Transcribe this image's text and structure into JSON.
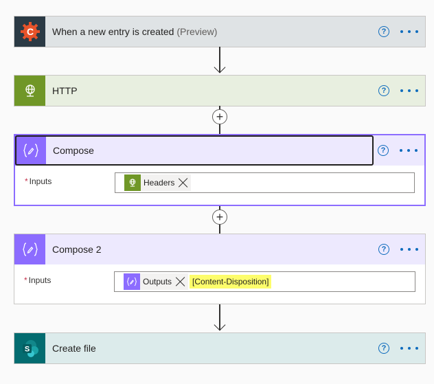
{
  "steps": [
    {
      "title": "When a new entry is created",
      "title_suffix": "(Preview)",
      "icon": "cognito-forms-icon"
    },
    {
      "title": "HTTP",
      "icon": "globe-icon"
    },
    {
      "title": "Compose",
      "icon": "compose-icon",
      "input_label": "Inputs",
      "required_mark": "*",
      "tokens": [
        {
          "label": "Headers",
          "icon": "globe-icon"
        }
      ]
    },
    {
      "title": "Compose 2",
      "icon": "compose-icon",
      "input_label": "Inputs",
      "required_mark": "*",
      "tokens": [
        {
          "label": "Outputs",
          "icon": "compose-icon"
        }
      ],
      "extra_text": "[Content-Disposition]"
    },
    {
      "title": "Create file",
      "icon": "sharepoint-icon"
    }
  ],
  "actions": {
    "help": "?",
    "plus": "+"
  },
  "colors": {
    "trigger_header": "#dfe3e5",
    "http_accent": "#709727",
    "compose_accent": "#8c6cff",
    "sharepoint_accent": "#036c70",
    "link_blue": "#0f6cbd",
    "highlight": "#fdfd6b"
  }
}
